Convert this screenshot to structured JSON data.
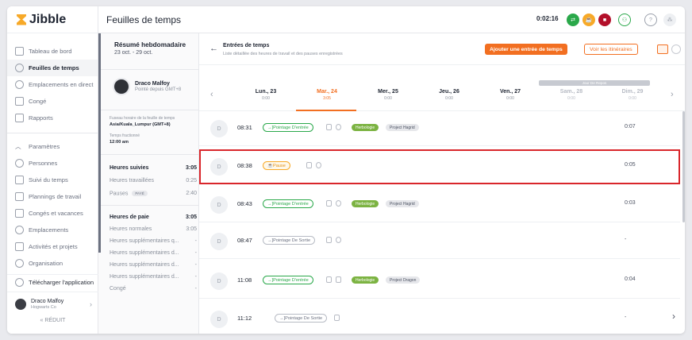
{
  "app": {
    "name": "Jibble",
    "page_title": "Feuilles de temps",
    "timer": "0:02:16"
  },
  "sidebar": {
    "items": [
      {
        "label": "Tableau de bord"
      },
      {
        "label": "Feuilles de temps"
      },
      {
        "label": "Emplacements en direct"
      },
      {
        "label": "Congé"
      },
      {
        "label": "Rapports"
      }
    ],
    "items2": [
      {
        "label": "Paramètres"
      },
      {
        "label": "Personnes"
      },
      {
        "label": "Suivi du temps"
      },
      {
        "label": "Plannings de travail"
      },
      {
        "label": "Congés et vacances"
      },
      {
        "label": "Emplacements"
      },
      {
        "label": "Activités et projets"
      },
      {
        "label": "Organisation"
      }
    ],
    "download": "Télécharger l'application",
    "user": {
      "name": "Draco Malfoy",
      "org": "Hogwarts Co"
    },
    "reduce": "« RÉDUIT"
  },
  "summary": {
    "title": "Résumé hebdomadaire",
    "dates": "23 oct. - 29 oct.",
    "person": {
      "name": "Draco Malfoy",
      "sub": "Pointé depuis GMT+8"
    },
    "tz_label": "Fuseau horaire de la feuille de temps",
    "tz_value": "Asia/Kuala_Lumpur (GMT+8)",
    "split_label": "Temps fractionné",
    "split_value": "12:00 am",
    "tracked": [
      {
        "label": "Heures suivies",
        "value": "3:05"
      },
      {
        "label": "Heures travaillées",
        "value": "0:25"
      },
      {
        "label": "Pauses",
        "value": "2:40",
        "badge": "PAYÉ"
      }
    ],
    "pay": [
      {
        "label": "Heures de paie",
        "value": "3:05"
      },
      {
        "label": "Heures normales",
        "value": "3:05"
      },
      {
        "label": "Heures supplémentaires q...",
        "value": "-"
      },
      {
        "label": "Heures supplémentaires d...",
        "value": "-"
      },
      {
        "label": "Heures supplémentaires d...",
        "value": "-"
      },
      {
        "label": "Heures supplémentaires d...",
        "value": "-"
      },
      {
        "label": "Congé",
        "value": "-"
      }
    ]
  },
  "entries_header": {
    "title": "Entrées de temps",
    "subtitle": "Liste détaillée des heures de travail et des pauses enregistrées",
    "add_label": "Ajouter une entrée de temps",
    "routes_label": "Voir les itinéraires"
  },
  "days": [
    {
      "name": "Lun., 23",
      "value": "0:00"
    },
    {
      "name": "Mar., 24",
      "value": "3:05"
    },
    {
      "name": "Mer., 25",
      "value": "0:00"
    },
    {
      "name": "Jeu., 26",
      "value": "0:00"
    },
    {
      "name": "Ven., 27",
      "value": "0:00"
    },
    {
      "name": "Sam., 28",
      "value": "0:00"
    },
    {
      "name": "Dim., 29",
      "value": "0:00"
    }
  ],
  "rest_day_label": "Jour De Repos",
  "entries": [
    {
      "initial": "D",
      "time": "08:31",
      "type": "Pointage D'entrée",
      "activity": "Herbologie",
      "project": "Project Hagrid",
      "duration": "0:07"
    },
    {
      "initial": "D",
      "time": "08:38",
      "type": "Pause",
      "activity": "",
      "project": "",
      "duration": "0:05"
    },
    {
      "initial": "D",
      "time": "08:43",
      "type": "Pointage D'entrée",
      "activity": "Herbologie",
      "project": "Project Hagrid",
      "duration": "0:03"
    },
    {
      "initial": "D",
      "time": "08:47",
      "type": "Pointage De Sortie",
      "activity": "",
      "project": "",
      "duration": "-"
    },
    {
      "initial": "D",
      "time": "11:08",
      "type": "Pointage D'entrée",
      "activity": "Herbologie",
      "project": "Project Dragon",
      "duration": "0:04"
    },
    {
      "initial": "D",
      "time": "11:12",
      "type": "Pointage De Sortie",
      "activity": "",
      "project": "",
      "duration": "-"
    }
  ],
  "colors": {
    "brand": "#f26f21",
    "accent_yellow": "#f7a928",
    "green": "#2aa84a",
    "highlight": "#d9262b"
  }
}
